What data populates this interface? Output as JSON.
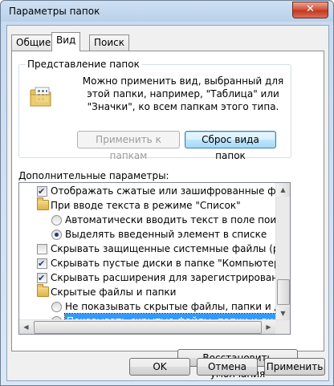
{
  "window": {
    "title": "Параметры папок",
    "close": "✕"
  },
  "tabs": [
    {
      "label": "Общие"
    },
    {
      "label": "Вид"
    },
    {
      "label": "Поиск"
    }
  ],
  "folder_view": {
    "group_label": "Представление папок",
    "description": "Можно применить вид, выбранный для этой папки, например, \"Таблица\" или \"Значки\", ко всем папкам этого типа.",
    "apply_button": "Применить к папкам",
    "reset_button": "Сброс вида папок"
  },
  "advanced": {
    "label": "Дополнительные параметры:",
    "items": [
      {
        "kind": "checkbox",
        "checked": true,
        "level": 1,
        "text": "Отображать сжатые или зашифрованные файлы NTFS"
      },
      {
        "kind": "folder",
        "level": 1,
        "text": "При вводе текста в режиме \"Список\""
      },
      {
        "kind": "radio",
        "checked": false,
        "level": 2,
        "text": "Автоматически вводить текст в поле поиска"
      },
      {
        "kind": "radio",
        "checked": true,
        "level": 2,
        "text": "Выделять введенный элемент в списке"
      },
      {
        "kind": "checkbox",
        "checked": false,
        "level": 1,
        "text": "Скрывать защищенные системные файлы (рекомендуется)"
      },
      {
        "kind": "checkbox",
        "checked": true,
        "level": 1,
        "text": "Скрывать пустые диски в папке \"Компьютер\""
      },
      {
        "kind": "checkbox",
        "checked": true,
        "level": 1,
        "text": "Скрывать расширения для зарегистрированных типов файлов"
      },
      {
        "kind": "folder",
        "level": 1,
        "text": "Скрытые файлы и папки"
      },
      {
        "kind": "radio",
        "checked": false,
        "level": 2,
        "text": "Не показывать скрытые файлы, папки и диски"
      },
      {
        "kind": "radio",
        "checked": true,
        "level": 2,
        "text": "Показывать скрытые файлы, папки и диски",
        "selected": true
      }
    ]
  },
  "restore_button": "Восстановить умолчания",
  "footer": {
    "ok": "OK",
    "cancel": "Отмена",
    "apply": "Применить"
  },
  "colors": {
    "selection": "#3399ff",
    "check": "#1a3d7a",
    "title_bar": "#b9d1ea"
  }
}
